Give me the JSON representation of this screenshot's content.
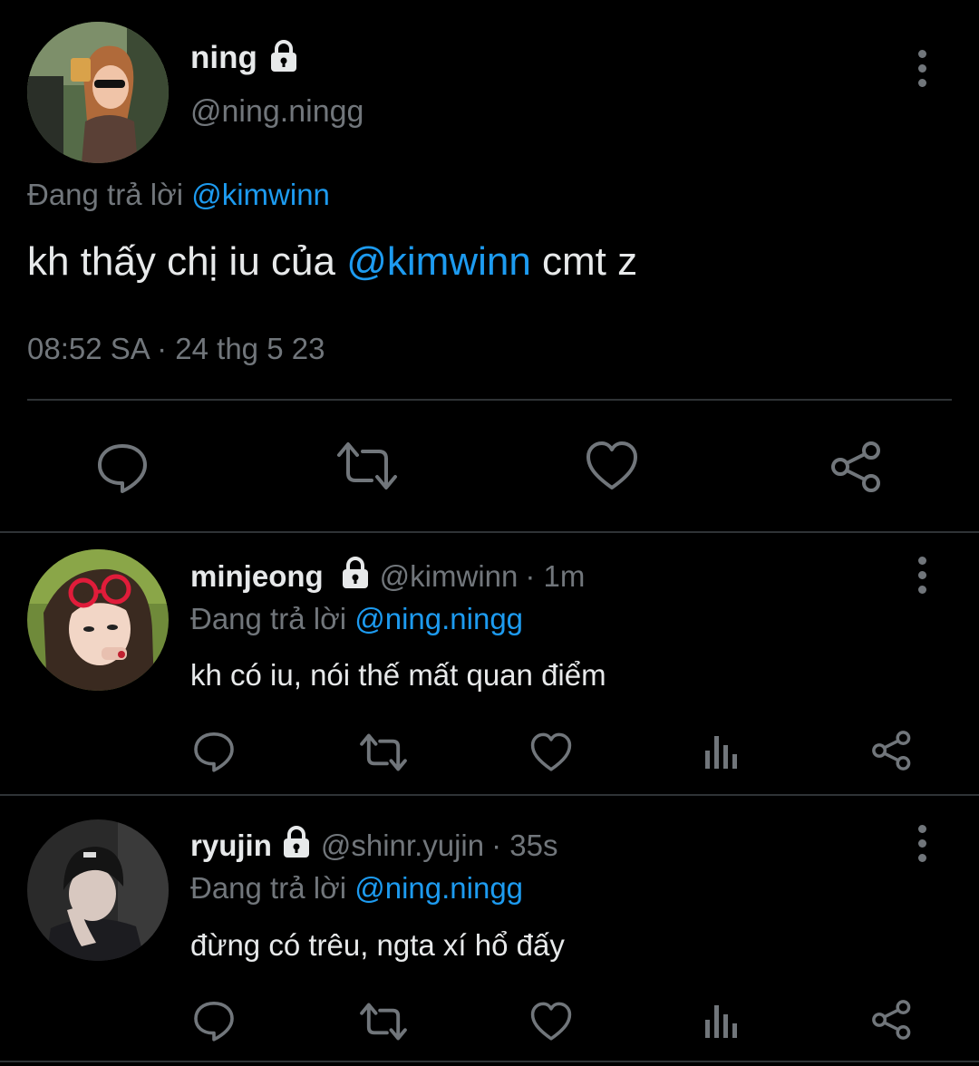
{
  "main_tweet": {
    "display_name": "ning",
    "handle": "@ning.ningg",
    "replying_prefix": "Đang trả lời",
    "replying_to": "@kimwinn",
    "text_before": "kh thấy chị iu của",
    "mention": "@kimwinn",
    "text_after": "cmt z",
    "timestamp": "08:52 SA · 24 thg 5 23",
    "actions": [
      "reply-icon",
      "retweet-icon",
      "like-icon",
      "share-icon"
    ]
  },
  "replies": [
    {
      "display_name": "minjeong",
      "handle": "@kimwinn",
      "time": "· 1m",
      "replying_prefix": "Đang trả lời",
      "replying_to": "@ning.ningg",
      "text": "kh có iu, nói thế mất quan điểm",
      "actions": [
        "reply-icon",
        "retweet-icon",
        "like-icon",
        "analytics-icon",
        "share-icon"
      ]
    },
    {
      "display_name": "ryujin",
      "handle": "@shinr.yujin",
      "time": "· 35s",
      "replying_prefix": "Đang trả lời",
      "replying_to": "@ning.ningg",
      "text": "đừng có trêu, ngta xí hổ đấy",
      "actions": [
        "reply-icon",
        "retweet-icon",
        "like-icon",
        "analytics-icon",
        "share-icon"
      ]
    }
  ],
  "colors": {
    "background": "#000000",
    "text": "#e7e9ea",
    "muted": "#71767b",
    "link": "#1d9bf0",
    "divider": "#2f3336"
  }
}
